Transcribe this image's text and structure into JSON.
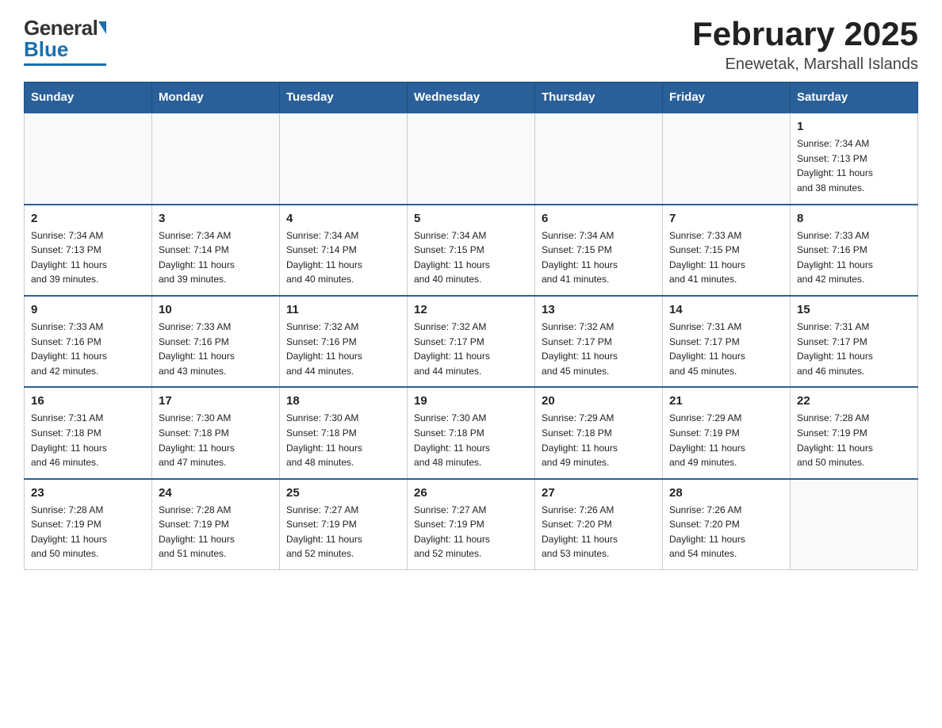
{
  "header": {
    "title": "February 2025",
    "subtitle": "Enewetak, Marshall Islands",
    "logo_general": "General",
    "logo_blue": "Blue"
  },
  "days_of_week": [
    "Sunday",
    "Monday",
    "Tuesday",
    "Wednesday",
    "Thursday",
    "Friday",
    "Saturday"
  ],
  "weeks": [
    [
      {
        "num": "",
        "info": ""
      },
      {
        "num": "",
        "info": ""
      },
      {
        "num": "",
        "info": ""
      },
      {
        "num": "",
        "info": ""
      },
      {
        "num": "",
        "info": ""
      },
      {
        "num": "",
        "info": ""
      },
      {
        "num": "1",
        "info": "Sunrise: 7:34 AM\nSunset: 7:13 PM\nDaylight: 11 hours\nand 38 minutes."
      }
    ],
    [
      {
        "num": "2",
        "info": "Sunrise: 7:34 AM\nSunset: 7:13 PM\nDaylight: 11 hours\nand 39 minutes."
      },
      {
        "num": "3",
        "info": "Sunrise: 7:34 AM\nSunset: 7:14 PM\nDaylight: 11 hours\nand 39 minutes."
      },
      {
        "num": "4",
        "info": "Sunrise: 7:34 AM\nSunset: 7:14 PM\nDaylight: 11 hours\nand 40 minutes."
      },
      {
        "num": "5",
        "info": "Sunrise: 7:34 AM\nSunset: 7:15 PM\nDaylight: 11 hours\nand 40 minutes."
      },
      {
        "num": "6",
        "info": "Sunrise: 7:34 AM\nSunset: 7:15 PM\nDaylight: 11 hours\nand 41 minutes."
      },
      {
        "num": "7",
        "info": "Sunrise: 7:33 AM\nSunset: 7:15 PM\nDaylight: 11 hours\nand 41 minutes."
      },
      {
        "num": "8",
        "info": "Sunrise: 7:33 AM\nSunset: 7:16 PM\nDaylight: 11 hours\nand 42 minutes."
      }
    ],
    [
      {
        "num": "9",
        "info": "Sunrise: 7:33 AM\nSunset: 7:16 PM\nDaylight: 11 hours\nand 42 minutes."
      },
      {
        "num": "10",
        "info": "Sunrise: 7:33 AM\nSunset: 7:16 PM\nDaylight: 11 hours\nand 43 minutes."
      },
      {
        "num": "11",
        "info": "Sunrise: 7:32 AM\nSunset: 7:16 PM\nDaylight: 11 hours\nand 44 minutes."
      },
      {
        "num": "12",
        "info": "Sunrise: 7:32 AM\nSunset: 7:17 PM\nDaylight: 11 hours\nand 44 minutes."
      },
      {
        "num": "13",
        "info": "Sunrise: 7:32 AM\nSunset: 7:17 PM\nDaylight: 11 hours\nand 45 minutes."
      },
      {
        "num": "14",
        "info": "Sunrise: 7:31 AM\nSunset: 7:17 PM\nDaylight: 11 hours\nand 45 minutes."
      },
      {
        "num": "15",
        "info": "Sunrise: 7:31 AM\nSunset: 7:17 PM\nDaylight: 11 hours\nand 46 minutes."
      }
    ],
    [
      {
        "num": "16",
        "info": "Sunrise: 7:31 AM\nSunset: 7:18 PM\nDaylight: 11 hours\nand 46 minutes."
      },
      {
        "num": "17",
        "info": "Sunrise: 7:30 AM\nSunset: 7:18 PM\nDaylight: 11 hours\nand 47 minutes."
      },
      {
        "num": "18",
        "info": "Sunrise: 7:30 AM\nSunset: 7:18 PM\nDaylight: 11 hours\nand 48 minutes."
      },
      {
        "num": "19",
        "info": "Sunrise: 7:30 AM\nSunset: 7:18 PM\nDaylight: 11 hours\nand 48 minutes."
      },
      {
        "num": "20",
        "info": "Sunrise: 7:29 AM\nSunset: 7:18 PM\nDaylight: 11 hours\nand 49 minutes."
      },
      {
        "num": "21",
        "info": "Sunrise: 7:29 AM\nSunset: 7:19 PM\nDaylight: 11 hours\nand 49 minutes."
      },
      {
        "num": "22",
        "info": "Sunrise: 7:28 AM\nSunset: 7:19 PM\nDaylight: 11 hours\nand 50 minutes."
      }
    ],
    [
      {
        "num": "23",
        "info": "Sunrise: 7:28 AM\nSunset: 7:19 PM\nDaylight: 11 hours\nand 50 minutes."
      },
      {
        "num": "24",
        "info": "Sunrise: 7:28 AM\nSunset: 7:19 PM\nDaylight: 11 hours\nand 51 minutes."
      },
      {
        "num": "25",
        "info": "Sunrise: 7:27 AM\nSunset: 7:19 PM\nDaylight: 11 hours\nand 52 minutes."
      },
      {
        "num": "26",
        "info": "Sunrise: 7:27 AM\nSunset: 7:19 PM\nDaylight: 11 hours\nand 52 minutes."
      },
      {
        "num": "27",
        "info": "Sunrise: 7:26 AM\nSunset: 7:20 PM\nDaylight: 11 hours\nand 53 minutes."
      },
      {
        "num": "28",
        "info": "Sunrise: 7:26 AM\nSunset: 7:20 PM\nDaylight: 11 hours\nand 54 minutes."
      },
      {
        "num": "",
        "info": ""
      }
    ]
  ]
}
